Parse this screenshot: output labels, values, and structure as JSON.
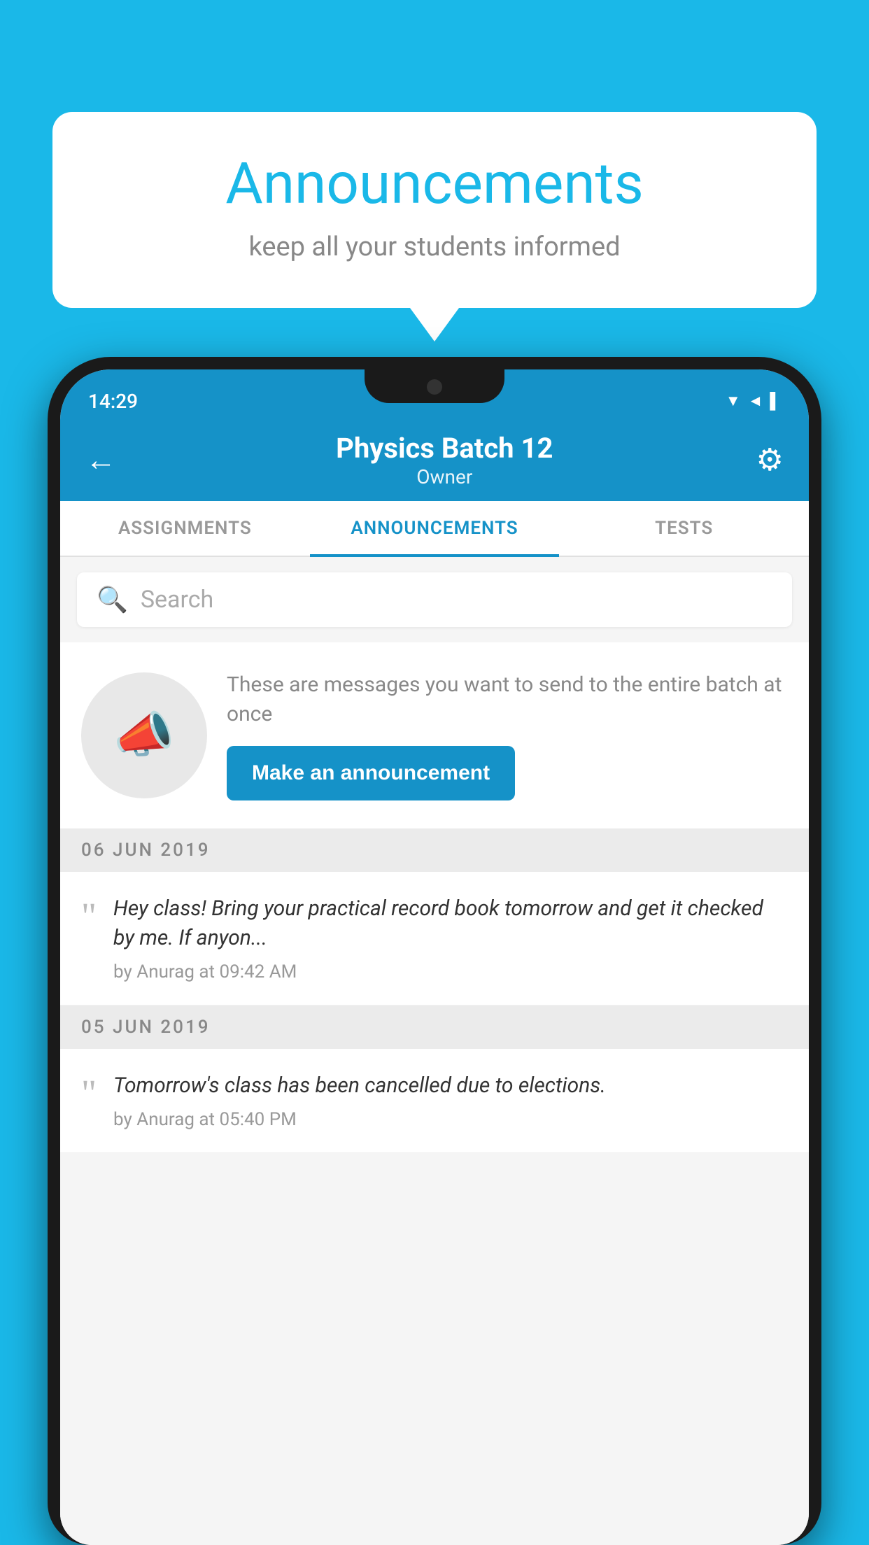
{
  "page": {
    "background_color": "#1ab8e8"
  },
  "hero": {
    "title": "Announcements",
    "subtitle": "keep all your students informed"
  },
  "phone": {
    "status_bar": {
      "time": "14:29",
      "icons": "▼◄▌"
    },
    "app_bar": {
      "title": "Physics Batch 12",
      "subtitle": "Owner",
      "back_icon": "←",
      "settings_icon": "⚙"
    },
    "tabs": [
      {
        "label": "ASSIGNMENTS",
        "active": false
      },
      {
        "label": "ANNOUNCEMENTS",
        "active": true
      },
      {
        "label": "TESTS",
        "active": false
      }
    ],
    "search": {
      "placeholder": "Search"
    },
    "promo": {
      "description_text": "These are messages you want to send to the entire batch at once",
      "cta_label": "Make an announcement"
    },
    "announcements": [
      {
        "date": "06  JUN  2019",
        "message": "Hey class! Bring your practical record book tomorrow and get it checked by me. If anyon...",
        "meta": "by Anurag at 09:42 AM"
      },
      {
        "date": "05  JUN  2019",
        "message": "Tomorrow's class has been cancelled due to elections.",
        "meta": "by Anurag at 05:40 PM"
      }
    ]
  }
}
